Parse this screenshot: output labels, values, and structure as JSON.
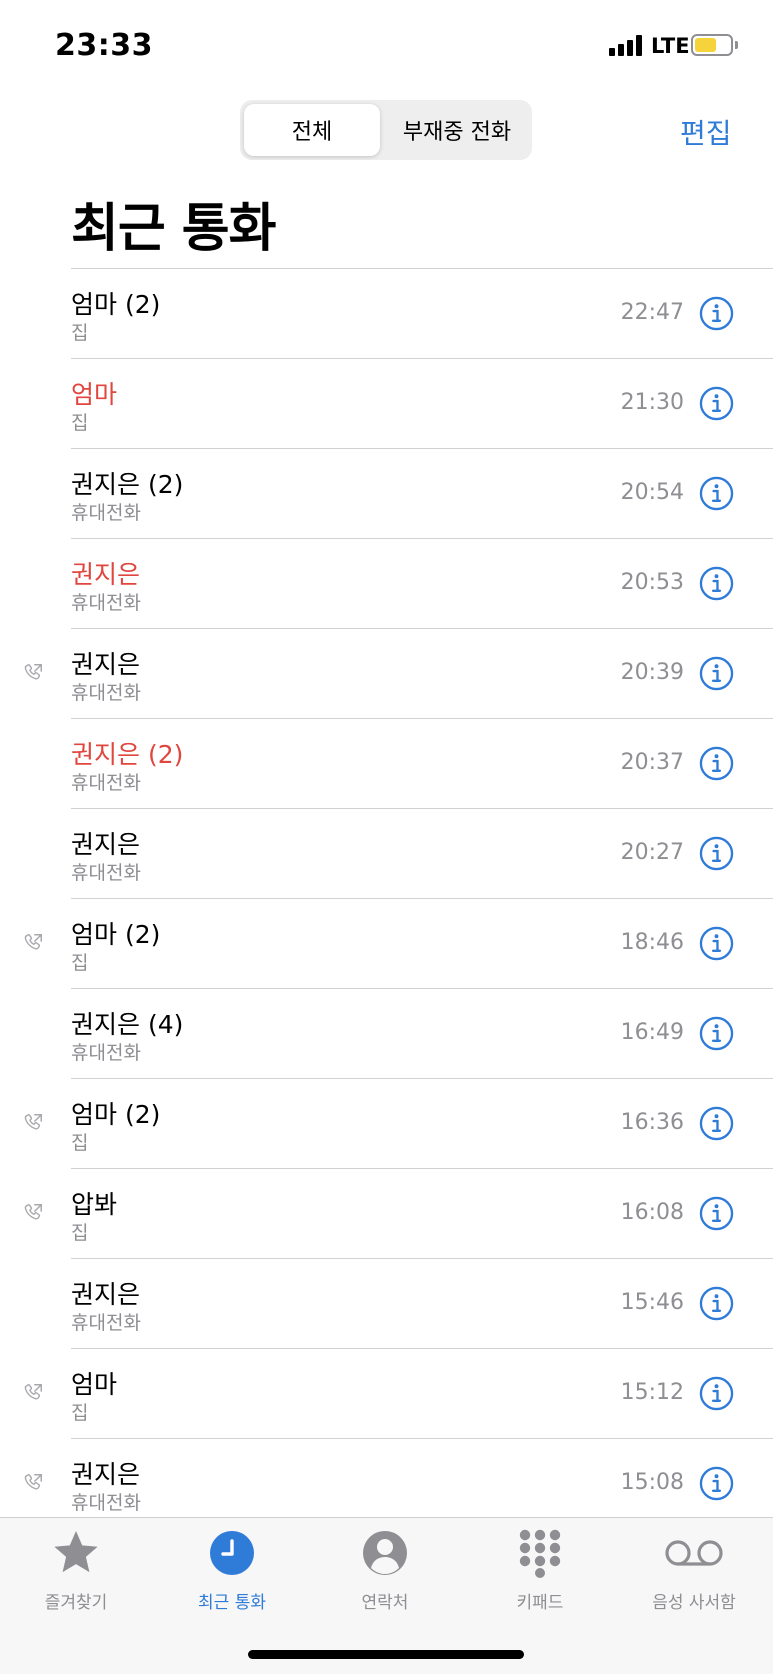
{
  "status_bar": {
    "time": "23:33",
    "network": "LTE",
    "battery_level": 0.62,
    "battery_color": "#f6d23b"
  },
  "header": {
    "segments": [
      "전체",
      "부재중 전화"
    ],
    "selected_segment": "전체",
    "edit_label": "편집",
    "title": "최근 통화"
  },
  "colors": {
    "accent": "#2f7bd8",
    "missed": "#e0463e",
    "secondary_text": "#8e8e93"
  },
  "calls": [
    {
      "name": "엄마 (2)",
      "type": "집",
      "time": "22:47",
      "missed": false,
      "outgoing": false
    },
    {
      "name": "엄마",
      "type": "집",
      "time": "21:30",
      "missed": true,
      "outgoing": false
    },
    {
      "name": "권지은 (2)",
      "type": "휴대전화",
      "time": "20:54",
      "missed": false,
      "outgoing": false
    },
    {
      "name": "권지은",
      "type": "휴대전화",
      "time": "20:53",
      "missed": true,
      "outgoing": false
    },
    {
      "name": "권지은",
      "type": "휴대전화",
      "time": "20:39",
      "missed": false,
      "outgoing": true
    },
    {
      "name": "권지은 (2)",
      "type": "휴대전화",
      "time": "20:37",
      "missed": true,
      "outgoing": false
    },
    {
      "name": "권지은",
      "type": "휴대전화",
      "time": "20:27",
      "missed": false,
      "outgoing": false
    },
    {
      "name": "엄마 (2)",
      "type": "집",
      "time": "18:46",
      "missed": false,
      "outgoing": true
    },
    {
      "name": "권지은 (4)",
      "type": "휴대전화",
      "time": "16:49",
      "missed": false,
      "outgoing": false
    },
    {
      "name": "엄마 (2)",
      "type": "집",
      "time": "16:36",
      "missed": false,
      "outgoing": true
    },
    {
      "name": "압봐",
      "type": "집",
      "time": "16:08",
      "missed": false,
      "outgoing": true
    },
    {
      "name": "권지은",
      "type": "휴대전화",
      "time": "15:46",
      "missed": false,
      "outgoing": false
    },
    {
      "name": "엄마",
      "type": "집",
      "time": "15:12",
      "missed": false,
      "outgoing": true
    },
    {
      "name": "권지은",
      "type": "휴대전화",
      "time": "15:08",
      "missed": false,
      "outgoing": true
    }
  ],
  "tabs": [
    {
      "label": "즐겨찾기",
      "icon": "star-icon",
      "active": false
    },
    {
      "label": "최근 통화",
      "icon": "clock-icon",
      "active": true
    },
    {
      "label": "연락처",
      "icon": "person-icon",
      "active": false
    },
    {
      "label": "키패드",
      "icon": "keypad-icon",
      "active": false
    },
    {
      "label": "음성 사서함",
      "icon": "voicemail-icon",
      "active": false
    }
  ]
}
